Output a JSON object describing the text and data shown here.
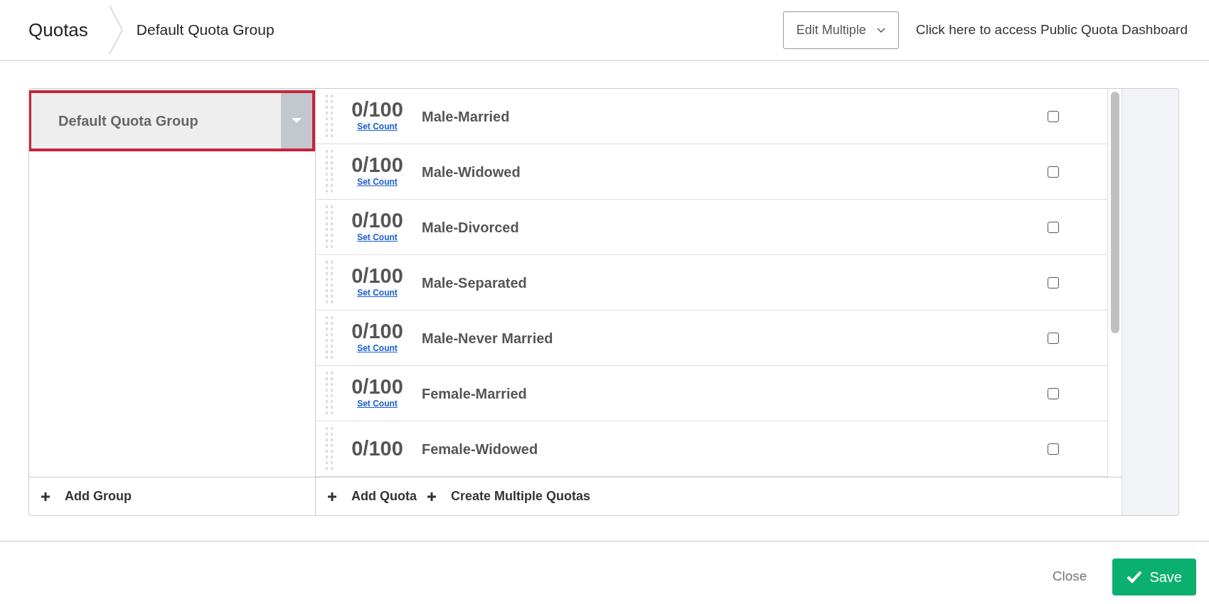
{
  "breadcrumb": [
    "Quotas",
    "Default Quota Group"
  ],
  "header_actions": {
    "edit_multiple": "Edit Multiple",
    "dashboard_link": "Click here to access Public Quota Dashboard"
  },
  "groups": [
    {
      "label": "Default Quota Group",
      "selected": true
    }
  ],
  "add_group": "Add Group",
  "quotas": [
    {
      "count": "0/100",
      "set_count": "Set Count",
      "name": "Male-Married",
      "checked": false
    },
    {
      "count": "0/100",
      "set_count": "Set Count",
      "name": "Male-Widowed",
      "checked": false
    },
    {
      "count": "0/100",
      "set_count": "Set Count",
      "name": "Male-Divorced",
      "checked": false
    },
    {
      "count": "0/100",
      "set_count": "Set Count",
      "name": "Male-Separated",
      "checked": false
    },
    {
      "count": "0/100",
      "set_count": "Set Count",
      "name": "Male-Never Married",
      "checked": false
    },
    {
      "count": "0/100",
      "set_count": "Set Count",
      "name": "Female-Married",
      "checked": false
    },
    {
      "count": "0/100",
      "name": "Female-Widowed",
      "checked": false
    }
  ],
  "quota_actions": [
    "Add Quota",
    "Create Multiple Quotas"
  ],
  "footer": {
    "close": "Close",
    "save": "Save"
  }
}
